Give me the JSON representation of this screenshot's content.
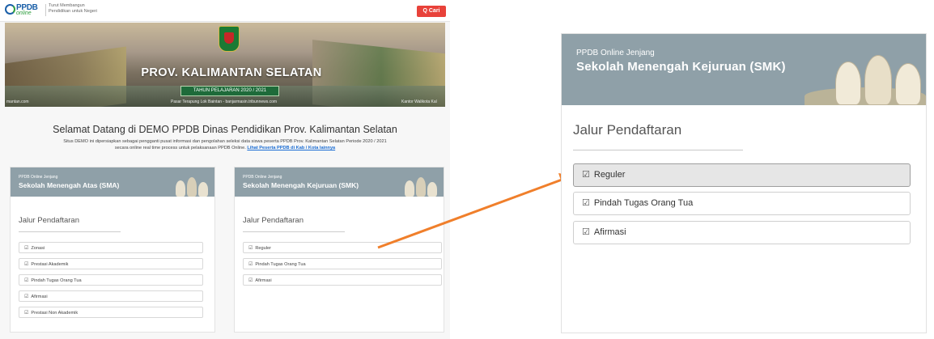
{
  "left_page": {
    "logo": {
      "brand": "PPDB",
      "sub": "online"
    },
    "tagline": "Turut Membangun Pendidikan untuk Negeri",
    "search_button": "Q Cari",
    "banner": {
      "title": "PROV. KALIMANTAN SELATAN",
      "year": "TAHUN PELAJARAN 2020 / 2021",
      "caption_left": "mantan.com",
      "caption_mid": "Pasar Terapung Lok Baintan - banjarmasin.tribunnews.com",
      "caption_right": "Kantor Walikota Kal"
    },
    "welcome": "Selamat Datang di DEMO PPDB Dinas Pendidikan Prov. Kalimantan Selatan",
    "description_1": "Situs DEMO ini dipersiapkan sebagai pengganti pusat informasi dan pengolahan seleksi data siswa peserta PPDB Prov. Kalimantan Selatan Periode 2020 / 2021",
    "description_2": "secara online real time process untuk pelaksanaan PPDB Online.",
    "description_link": "Lihat Peserta PPDB di Kab / Kota lainnya",
    "cards": [
      {
        "subtitle": "PPDB Online Jenjang",
        "title": "Sekolah Menengah Atas (SMA)",
        "section": "Jalur Pendaftaran",
        "options": [
          "Zonasi",
          "Prestasi Akademik",
          "Pindah Tugas Orang Tua",
          "Afirmasi",
          "Prestasi Non Akademik"
        ]
      },
      {
        "subtitle": "PPDB Online Jenjang",
        "title": "Sekolah Menengah Kejuruan (SMK)",
        "section": "Jalur Pendaftaran",
        "options": [
          "Reguler",
          "Pindah Tugas Orang Tua",
          "Afirmasi"
        ]
      }
    ]
  },
  "zoom_card": {
    "subtitle": "PPDB Online Jenjang",
    "title": "Sekolah Menengah Kejuruan (SMK)",
    "section": "Jalur Pendaftaran",
    "options": [
      "Reguler",
      "Pindah Tugas Orang Tua",
      "Afirmasi"
    ],
    "selected_index": 0
  },
  "colors": {
    "card_header": "#8fa0a8",
    "accent_red": "#e8423a",
    "arrow": "#f07f2b",
    "link": "#1a6cd3"
  },
  "icons": {
    "option_check": "check-square-icon",
    "search": "search-icon"
  }
}
